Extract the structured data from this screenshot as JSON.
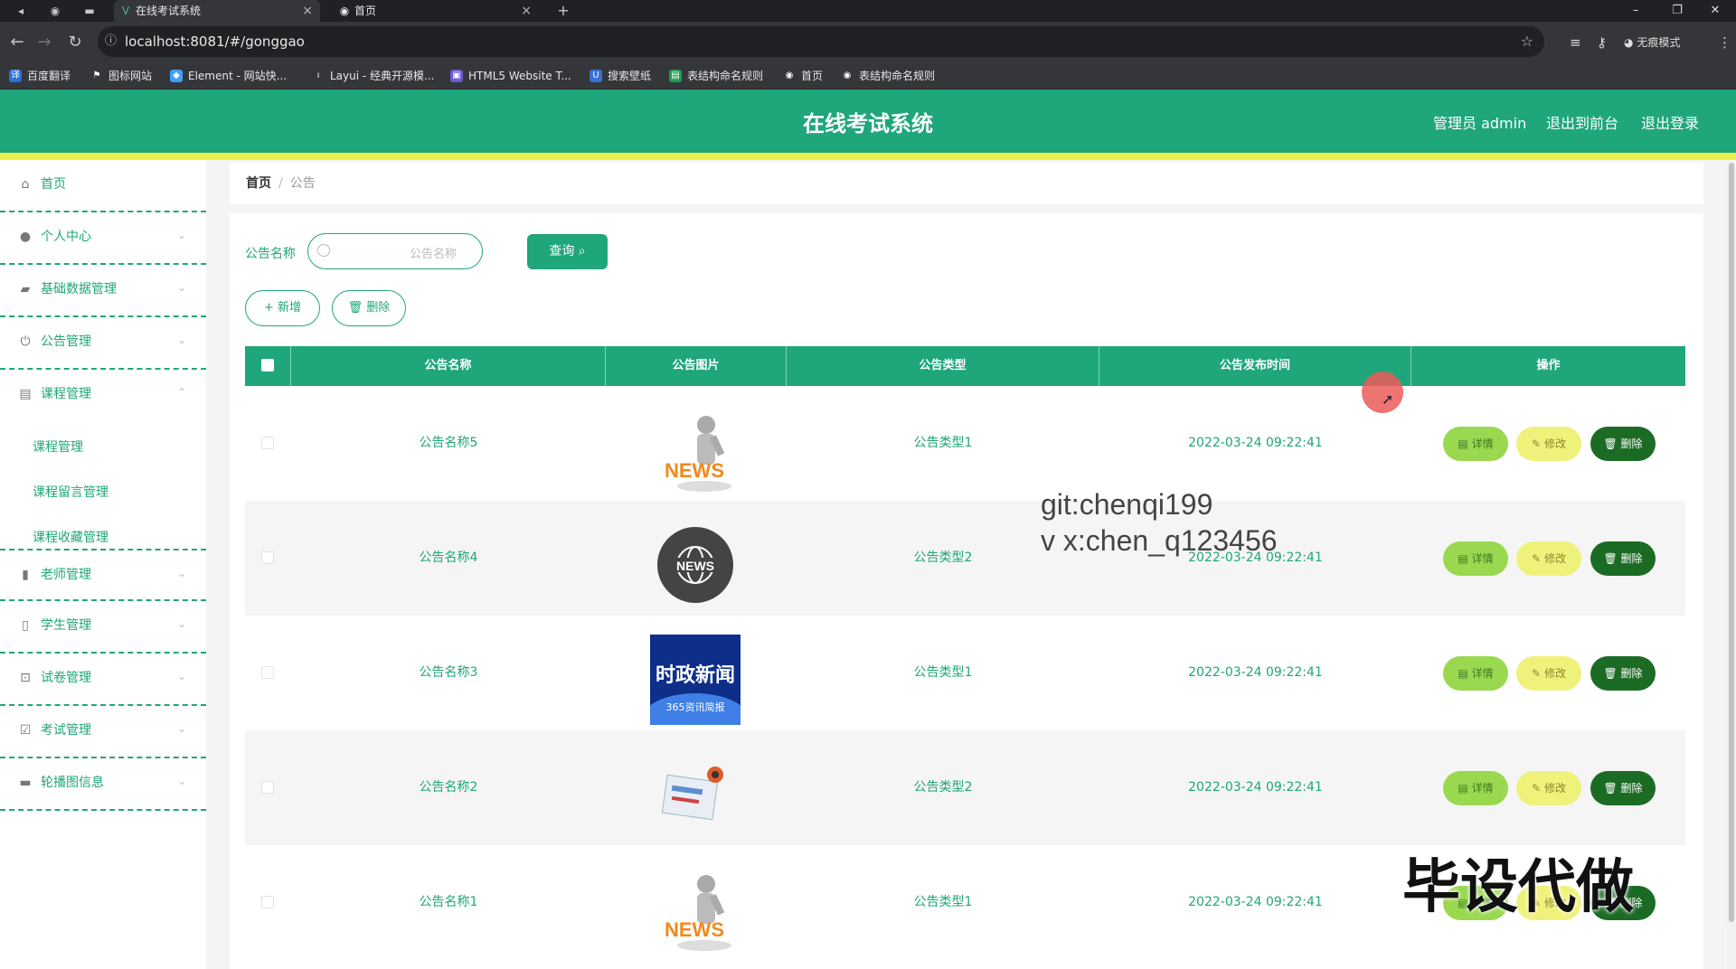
{
  "browser": {
    "tabs": [
      {
        "title": "在线考试系统",
        "active": true
      },
      {
        "title": "首页",
        "active": false
      }
    ],
    "url": "localhost:8081/#/gonggao",
    "incognito_label": "无痕模式",
    "bookmarks": [
      "百度翻译",
      "图标网站",
      "Element - 网站快...",
      "Layui - 经典开源模...",
      "HTML5 Website T...",
      "搜索壁纸",
      "表结构命名规则",
      "首页",
      "表结构命名规则"
    ]
  },
  "header": {
    "title": "在线考试系统",
    "admin_label": "管理员 admin",
    "back_front_label": "退出到前台",
    "logout_label": "退出登录"
  },
  "sidebar": {
    "items": [
      {
        "label": "首页",
        "icon": "home-icon"
      },
      {
        "label": "个人中心",
        "icon": "user-icon"
      },
      {
        "label": "基础数据管理",
        "icon": "briefcase-icon"
      },
      {
        "label": "公告管理",
        "icon": "power-icon"
      },
      {
        "label": "课程管理",
        "icon": "clipboard-icon"
      },
      {
        "label": "老师管理",
        "icon": "chart-icon"
      },
      {
        "label": "学生管理",
        "icon": "phone-icon"
      },
      {
        "label": "试卷管理",
        "icon": "crop-icon"
      },
      {
        "label": "考试管理",
        "icon": "check-icon"
      },
      {
        "label": "轮播图信息",
        "icon": "monitor-icon"
      }
    ],
    "sub_items": [
      "课程管理",
      "课程留言管理",
      "课程收藏管理"
    ]
  },
  "breadcrumb": {
    "home": "首页",
    "separator": "/",
    "current": "公告"
  },
  "search": {
    "label": "公告名称",
    "placeholder": "公告名称",
    "query_button": "查询"
  },
  "actions": {
    "add": "新增",
    "delete": "删除"
  },
  "table": {
    "headers": [
      "公告名称",
      "公告图片",
      "公告类型",
      "公告发布时间",
      "操作"
    ],
    "rows": [
      {
        "name": "公告名称5",
        "image": "news-figure",
        "type": "公告类型1",
        "time": "2022-03-24 09:22:41"
      },
      {
        "name": "公告名称4",
        "image": "news-globe",
        "type": "公告类型2",
        "time": "2022-03-24 09:22:41"
      },
      {
        "name": "公告名称3",
        "image": "shizheng-news",
        "type": "公告类型1",
        "time": "2022-03-24 09:22:41"
      },
      {
        "name": "公告名称2",
        "image": "news-paper",
        "type": "公告类型2",
        "time": "2022-03-24 09:22:41"
      },
      {
        "name": "公告名称1",
        "image": "news-figure",
        "type": "公告类型1",
        "time": "2022-03-24 09:22:41"
      }
    ],
    "row_buttons": {
      "detail": "详情",
      "edit": "修改",
      "delete": "删除"
    }
  },
  "images": {
    "globe_text": "NEWS",
    "news_text": "NEWS",
    "shizheng_title": "时政新闻",
    "shizheng_sub": "365资讯简报"
  },
  "overlays": {
    "watermark_line1": "git:chenqi199",
    "watermark_line2": "v x:chen_q123456",
    "stamp": "毕设代做"
  },
  "colors": {
    "primary": "#1fa67a",
    "accent_bar": "#e8ef4a",
    "detail_btn": "#9ad84f",
    "edit_btn": "#eff27a",
    "delete_btn": "#1c6b25"
  }
}
